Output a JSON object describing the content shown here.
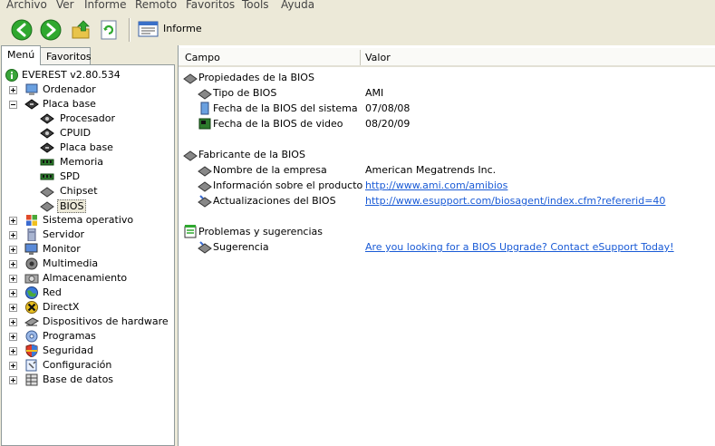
{
  "menubar": {
    "items": [
      "Archivo",
      "Ver",
      "Informe",
      "Remoto",
      "Favoritos",
      "Tools",
      "Ayuda"
    ]
  },
  "toolbar": {
    "informe_label": "Informe"
  },
  "tabs": {
    "menu": "Menú",
    "favoritos": "Favoritos"
  },
  "tree": {
    "root": "EVEREST v2.80.534",
    "items": [
      {
        "label": "Ordenador",
        "icon": "computer-icon"
      },
      {
        "label": "Placa base",
        "icon": "motherboard-icon"
      },
      {
        "label": "Procesador",
        "icon": "cpu-icon"
      },
      {
        "label": "CPUID",
        "icon": "cpu-icon"
      },
      {
        "label": "Placa base",
        "icon": "motherboard-icon"
      },
      {
        "label": "Memoria",
        "icon": "memory-icon"
      },
      {
        "label": "SPD",
        "icon": "memory-icon"
      },
      {
        "label": "Chipset",
        "icon": "chip-icon"
      },
      {
        "label": "BIOS",
        "icon": "chip-icon"
      },
      {
        "label": "Sistema operativo",
        "icon": "windows-icon"
      },
      {
        "label": "Servidor",
        "icon": "server-icon"
      },
      {
        "label": "Monitor",
        "icon": "monitor-icon"
      },
      {
        "label": "Multimedia",
        "icon": "speaker-icon"
      },
      {
        "label": "Almacenamiento",
        "icon": "disk-icon"
      },
      {
        "label": "Red",
        "icon": "globe-icon"
      },
      {
        "label": "DirectX",
        "icon": "directx-icon"
      },
      {
        "label": "Dispositivos de hardware",
        "icon": "hardware-icon"
      },
      {
        "label": "Programas",
        "icon": "programs-icon"
      },
      {
        "label": "Seguridad",
        "icon": "shield-icon"
      },
      {
        "label": "Configuración",
        "icon": "config-icon"
      },
      {
        "label": "Base de datos",
        "icon": "database-icon"
      }
    ]
  },
  "columns": {
    "campo": "Campo",
    "valor": "Valor"
  },
  "report": {
    "sec1_title": "Propiedades de la BIOS",
    "tipo_label": "Tipo de BIOS",
    "tipo_value": "AMI",
    "fecha_sistema_label": "Fecha de la BIOS del sistema",
    "fecha_sistema_value": "07/08/08",
    "fecha_video_label": "Fecha de la BIOS de video",
    "fecha_video_value": "08/20/09",
    "sec2_title": "Fabricante de la BIOS",
    "empresa_label": "Nombre de la empresa",
    "empresa_value": "American Megatrends Inc.",
    "info_label": "Información sobre el producto",
    "info_value": "http://www.ami.com/amibios",
    "update_label": "Actualizaciones del BIOS",
    "update_value": "http://www.esupport.com/biosagent/index.cfm?refererid=40",
    "sec3_title": "Problemas y sugerencias",
    "sugerencia_label": "Sugerencia",
    "sugerencia_value": "Are you looking for a BIOS Upgrade?  Contact eSupport Today!"
  },
  "colors": {
    "link": "#1a5bd6",
    "nav_green": "#2fa82f",
    "panel_border": "#919b9c"
  }
}
